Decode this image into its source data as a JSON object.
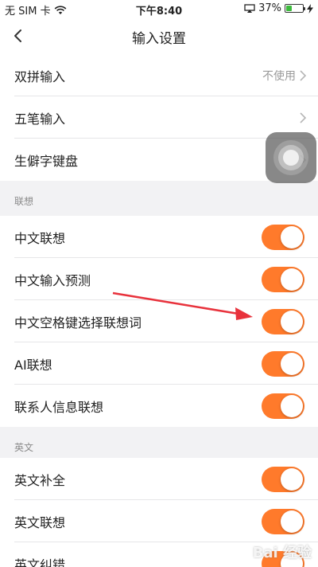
{
  "status_bar": {
    "carrier": "无 SIM 卡",
    "time": "下午8:40",
    "battery_percent": "37%",
    "battery_level": 0.37,
    "battery_color": "#3dbb3d"
  },
  "nav": {
    "title": "输入设置",
    "back_icon": "chevron-left-icon"
  },
  "rows_top": [
    {
      "label": "双拼输入",
      "value": "不使用"
    },
    {
      "label": "五笔输入",
      "value": ""
    },
    {
      "label": "生僻字键盘",
      "value": ""
    }
  ],
  "sections": [
    {
      "title": "联想",
      "items": [
        {
          "label": "中文联想",
          "on": true
        },
        {
          "label": "中文输入预测",
          "on": true
        },
        {
          "label": "中文空格键选择联想词",
          "on": true
        },
        {
          "label": "AI联想",
          "on": true
        },
        {
          "label": "联系人信息联想",
          "on": true
        }
      ]
    },
    {
      "title": "英文",
      "items": [
        {
          "label": "英文补全",
          "on": true
        },
        {
          "label": "英文联想",
          "on": true
        },
        {
          "label": "英文纠错",
          "on": true
        }
      ]
    }
  ],
  "colors": {
    "toggle_on": "#ff7a2b",
    "annotation_arrow": "#e8323c"
  },
  "watermark": "Bai 经验"
}
